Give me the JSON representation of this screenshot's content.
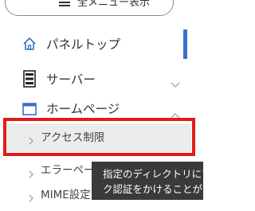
{
  "menu_button": {
    "label": "全メニュー表示"
  },
  "nav": {
    "items": [
      {
        "label": "パネルトップ",
        "icon": "home-icon"
      },
      {
        "label": "サーバー",
        "icon": "server-icon",
        "chevron": "chevron-down-icon"
      },
      {
        "label": "ホームページ",
        "icon": "window-icon",
        "chevron": "chevron-up-icon"
      }
    ],
    "sub_items": [
      {
        "label": "アクセス制限"
      },
      {
        "label": "エラーページ設定"
      },
      {
        "label": "MIME設定"
      }
    ]
  },
  "tooltip": {
    "lines": [
      "指定のディレクトリにア",
      "ク認証をかけることがで"
    ]
  },
  "colors": {
    "accent": "#3b6fcf",
    "highlight": "#e31b1b",
    "tooltip_bg": "#3a3a3a",
    "active_bg": "#ececec"
  }
}
